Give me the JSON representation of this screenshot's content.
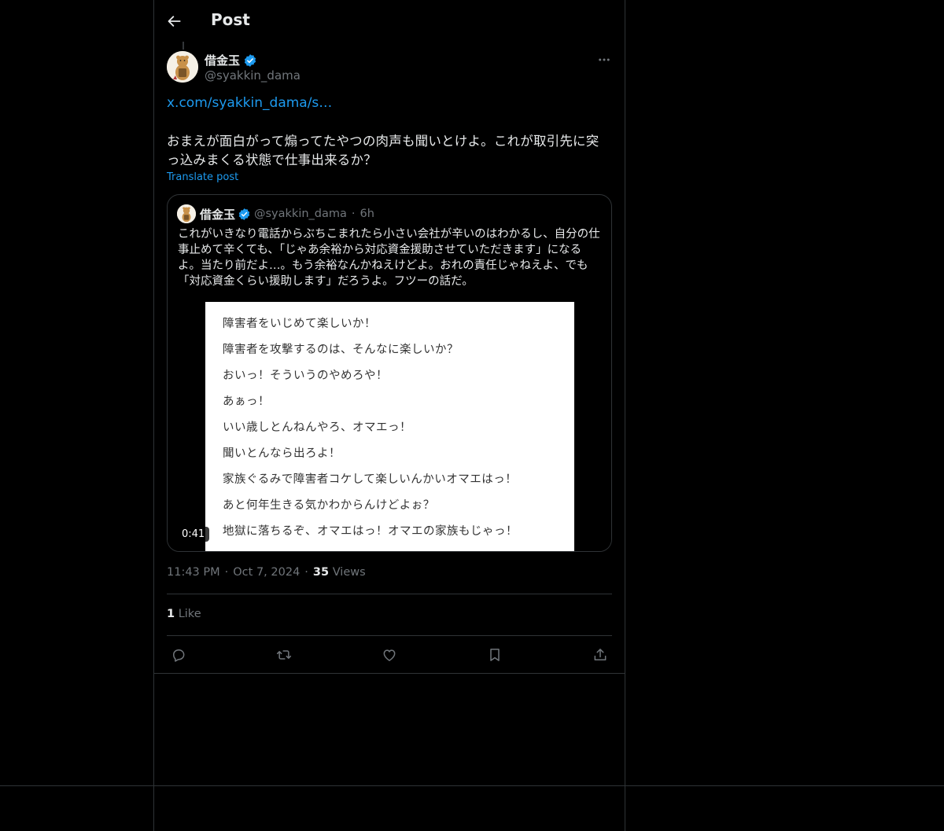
{
  "header": {
    "title": "Post"
  },
  "author": {
    "name": "借金玉",
    "handle": "@syakkin_dama"
  },
  "tweet": {
    "link": "x.com/syakkin_dama/s…",
    "text": "おまえが面白がって煽ってたやつの肉声も聞いとけよ。これが取引先に突っ込みまくる状態で仕事出来るか？",
    "translate_label": "Translate post"
  },
  "quote": {
    "name": "借金玉",
    "handle": "@syakkin_dama",
    "time": "6h",
    "text": "これがいきなり電話からぶちこまれたら小さい会社が辛いのはわかるし、自分の仕事止めて辛くても、「じゃあ余裕から対応資金援助させていただきます」になるよ。当たり前だよ…。もう余裕なんかねえけどよ。おれの責任じゃねえよ、でも「対応資金くらい援助します」だろうよ。フツーの話だ。",
    "video_duration": "0:41",
    "transcript": [
      "障害者をいじめて楽しいか！",
      "障害者を攻撃するのは、そんなに楽しいか？",
      "おいっ！そういうのやめろや！",
      "あぁっ！",
      "いい歳しとんねんやろ、オマエっ！",
      "聞いとんなら出ろよ！",
      "家族ぐるみで障害者コケして楽しいんかいオマエはっ！",
      "あと何年生きる気かわからんけどよぉ？",
      "地獄に落ちるぞ、オマエはっ！オマエの家族もじゃっ！"
    ]
  },
  "meta": {
    "time": "11:43 PM",
    "date": "Oct 7, 2024",
    "views_count": "35",
    "views_label": "Views",
    "likes_count": "1",
    "likes_label": "Like"
  },
  "colors": {
    "accent": "#1d9bf0",
    "muted": "#71767b",
    "border": "#2f3336"
  }
}
